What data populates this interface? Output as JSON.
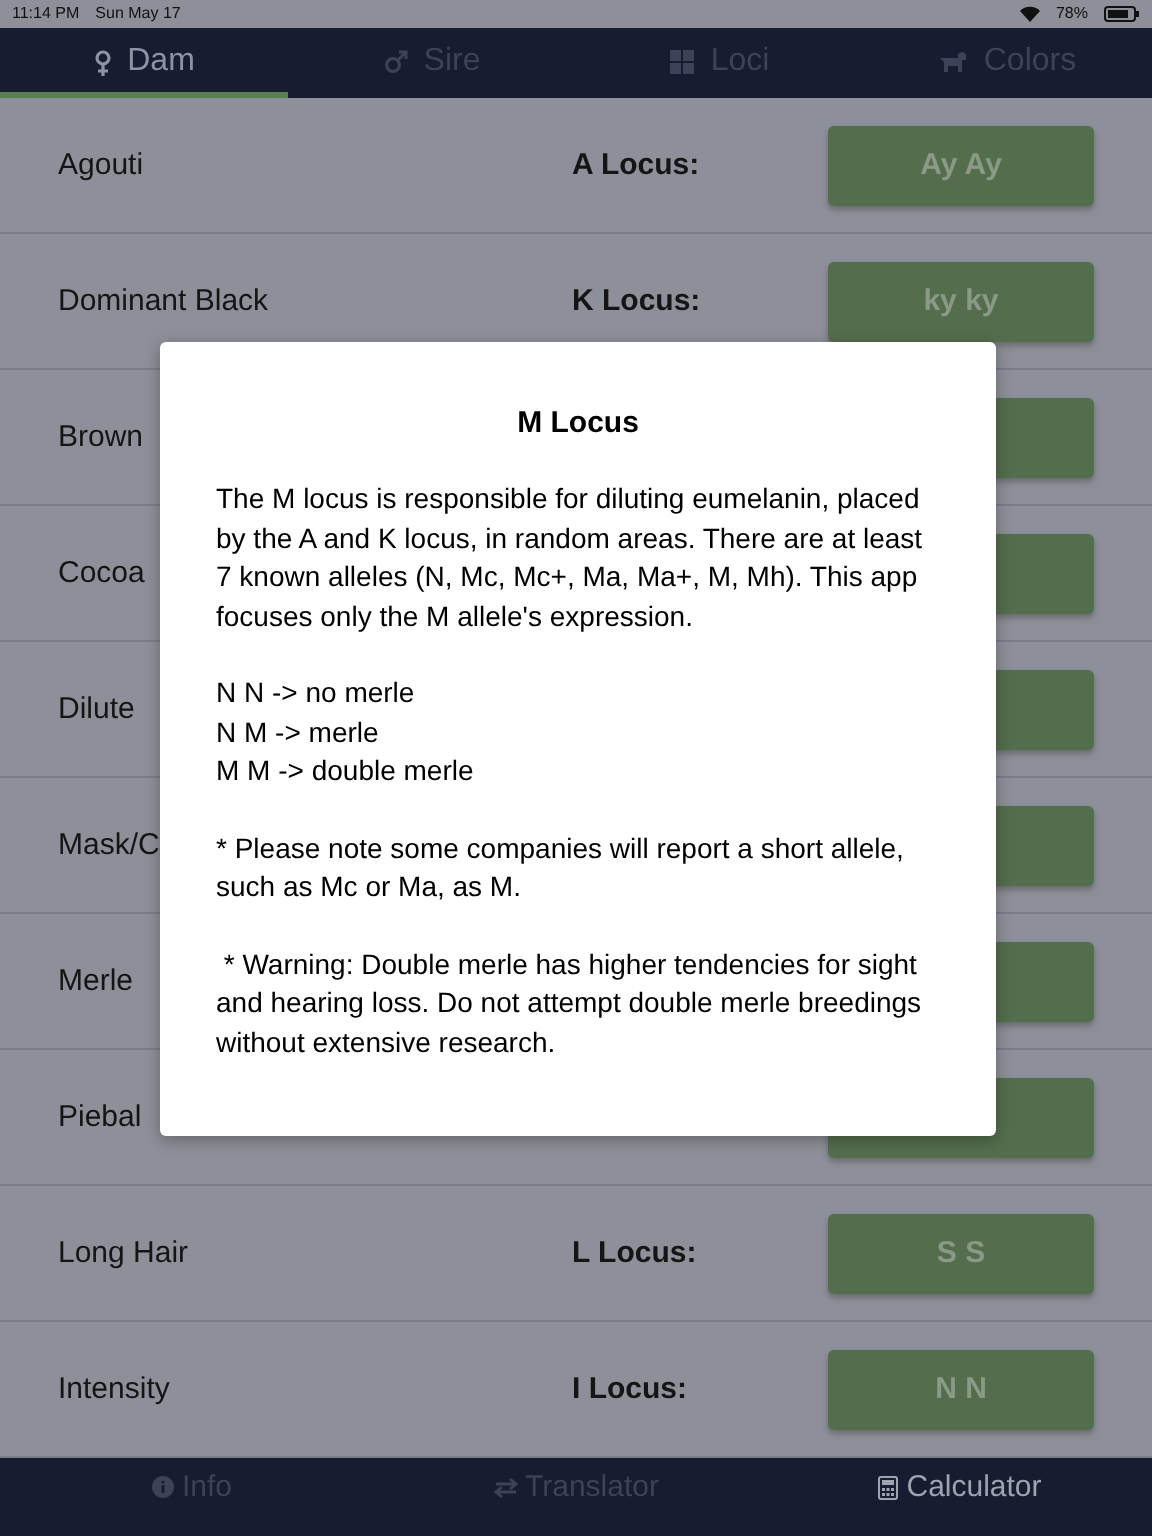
{
  "status_bar": {
    "time": "11:14 PM",
    "date": "Sun May 17",
    "battery": "78%"
  },
  "tabs": [
    {
      "label": "Dam",
      "selected": true
    },
    {
      "label": "Sire",
      "selected": false
    },
    {
      "label": "Loci",
      "selected": false
    },
    {
      "label": "Colors",
      "selected": false
    }
  ],
  "rows": [
    {
      "label": "Agouti",
      "locus": "A Locus:",
      "value": "Ay Ay"
    },
    {
      "label": "Dominant Black",
      "locus": "K Locus:",
      "value": "ky ky"
    },
    {
      "label": "Brown"
    },
    {
      "label": "Cocoa"
    },
    {
      "label": "Dilute"
    },
    {
      "label": "Mask/C"
    },
    {
      "label": "Merle"
    },
    {
      "label": "Piebal"
    },
    {
      "label": "Long Hair",
      "locus": "L Locus:",
      "value": "S S"
    },
    {
      "label": "Intensity",
      "locus": "I Locus:",
      "value": "N N"
    }
  ],
  "dialog": {
    "title": "M Locus",
    "paragraphs": [
      {
        "lines": [
          "The M locus is responsible for diluting eumelanin, placed by the A and K locus, in random areas. There are at least 7 known alleles (N, Mc, Mc+, Ma, Ma+, M, Mh). This app focuses only the M allele's expression."
        ]
      },
      {
        "lines": [
          "N N -> no merle",
          "N M -> merle",
          "M M -> double merle"
        ]
      },
      {
        "lines": [
          "* Please note some companies will report a short allele, such as Mc or Ma, as M."
        ]
      },
      {
        "lines": [
          " * Warning: Double merle has higher tendencies for sight and hearing loss. Do not attempt double merle breedings without extensive research."
        ]
      }
    ]
  },
  "bottom_tabs": [
    {
      "label": "Info",
      "selected": false
    },
    {
      "label": "Translator",
      "selected": false
    },
    {
      "label": "Calculator",
      "selected": true
    }
  ]
}
